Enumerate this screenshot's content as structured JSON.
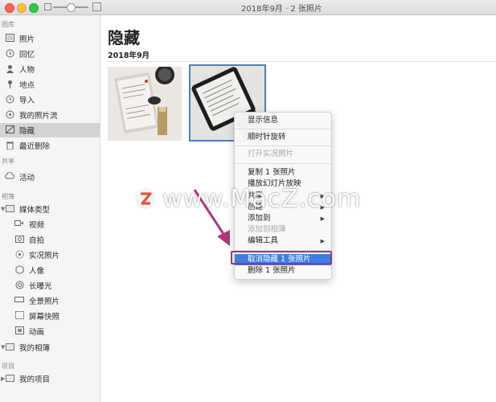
{
  "window": {
    "title": "2018年9月 · 2 张照片"
  },
  "sidebar": {
    "headers": {
      "library": "图库",
      "shared": "共享",
      "albums": "相簿",
      "projects": "项目"
    },
    "library_items": [
      {
        "label": "照片",
        "icon": "photos-icon"
      },
      {
        "label": "回忆",
        "icon": "memories-icon"
      },
      {
        "label": "人物",
        "icon": "people-icon"
      },
      {
        "label": "地点",
        "icon": "places-icon"
      },
      {
        "label": "导入",
        "icon": "import-icon"
      },
      {
        "label": "我的照片流",
        "icon": "photostream-icon"
      },
      {
        "label": "隐藏",
        "icon": "hidden-icon",
        "selected": true
      },
      {
        "label": "最近删除",
        "icon": "trash-icon"
      }
    ],
    "shared_items": [
      {
        "label": "活动",
        "icon": "cloud-icon"
      }
    ],
    "album_items": [
      {
        "label": "媒体类型",
        "icon": "folder-icon"
      },
      {
        "label": "视频",
        "icon": "video-icon"
      },
      {
        "label": "自拍",
        "icon": "selfie-icon"
      },
      {
        "label": "实况照片",
        "icon": "live-photo-icon"
      },
      {
        "label": "人像",
        "icon": "portrait-icon"
      },
      {
        "label": "长曝光",
        "icon": "long-exposure-icon"
      },
      {
        "label": "全景照片",
        "icon": "panorama-icon"
      },
      {
        "label": "屏幕快照",
        "icon": "screenshot-icon"
      },
      {
        "label": "动画",
        "icon": "animated-icon"
      },
      {
        "label": "我的相簿",
        "icon": "folder-icon"
      }
    ],
    "project_items": [
      {
        "label": "我的项目",
        "icon": "folder-icon"
      }
    ]
  },
  "main": {
    "title": "隐藏",
    "section_date": "2018年9月"
  },
  "context_menu": {
    "items": [
      {
        "label": "显示信息",
        "enabled": true
      },
      {
        "label": "顺时针旋转",
        "enabled": true
      },
      {
        "label": "打开实况照片",
        "enabled": false
      },
      {
        "label": "复制 1 张照片",
        "enabled": true
      },
      {
        "label": "播放幻灯片放映",
        "enabled": true
      },
      {
        "label": "共享",
        "enabled": true,
        "submenu": true
      },
      {
        "label": "创建",
        "enabled": true,
        "submenu": true
      },
      {
        "label": "添加到",
        "enabled": true,
        "submenu": true
      },
      {
        "label": "添加到相簿",
        "enabled": false
      },
      {
        "label": "编辑工具",
        "enabled": true,
        "submenu": true
      },
      {
        "label": "取消隐藏 1 张照片",
        "enabled": true,
        "highlighted": true
      },
      {
        "label": "删除 1 张照片",
        "enabled": true
      }
    ]
  },
  "watermark": {
    "badge": "Z",
    "text": "www.MacZ.com"
  },
  "colors": {
    "selection_blue": "#3d7de0",
    "annotation_magenta": "#a5307f",
    "thumb_border": "#4a7fc1"
  },
  "zoom": {
    "level": 0.5
  }
}
